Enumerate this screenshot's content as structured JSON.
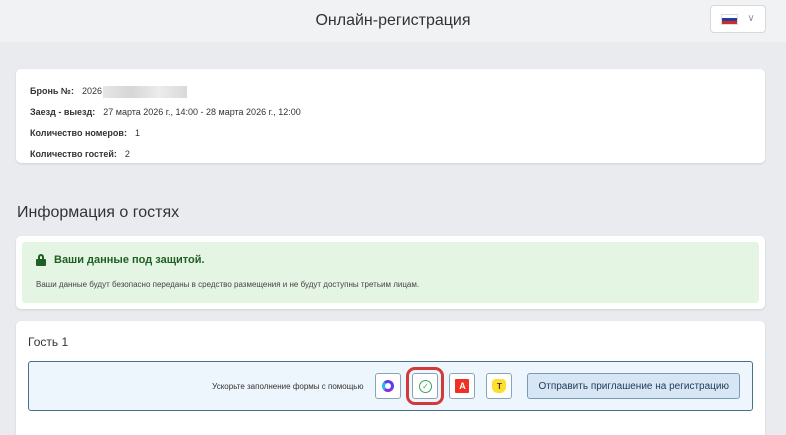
{
  "header": {
    "title": "Онлайн-регистрация",
    "language_icon": "russia-flag-icon",
    "flag_colors": [
      "#ffffff",
      "#1c3fa8",
      "#d52b1e"
    ]
  },
  "booking": {
    "number_label": "Бронь №:",
    "number_value": "2026",
    "dates_label": "Заезд - выезд:",
    "dates_value": "27 марта 2026 г., 14:00 - 28 марта 2026 г., 12:00",
    "rooms_label": "Количество номеров:",
    "rooms_value": "1",
    "guests_label": "Количество гостей:",
    "guests_value": "2"
  },
  "guests_section": {
    "title": "Информация о гостях"
  },
  "security": {
    "title": "Ваши данные под защитой.",
    "text": "Ваши данные будут безопасно переданы в средство размещения и не будут доступны третьим лицам."
  },
  "guest": {
    "title": "Гость 1",
    "autofill_label": "Ускорьте заполнение формы с помощью",
    "services": [
      {
        "icon": "ring-logo-icon"
      },
      {
        "icon": "check-circle-icon",
        "glyph": "✓"
      },
      {
        "icon": "alfa-logo-icon",
        "glyph": "A"
      },
      {
        "icon": "shield-logo-icon",
        "glyph": "T"
      }
    ],
    "invite_button": "Отправить приглашение на регистрацию"
  }
}
